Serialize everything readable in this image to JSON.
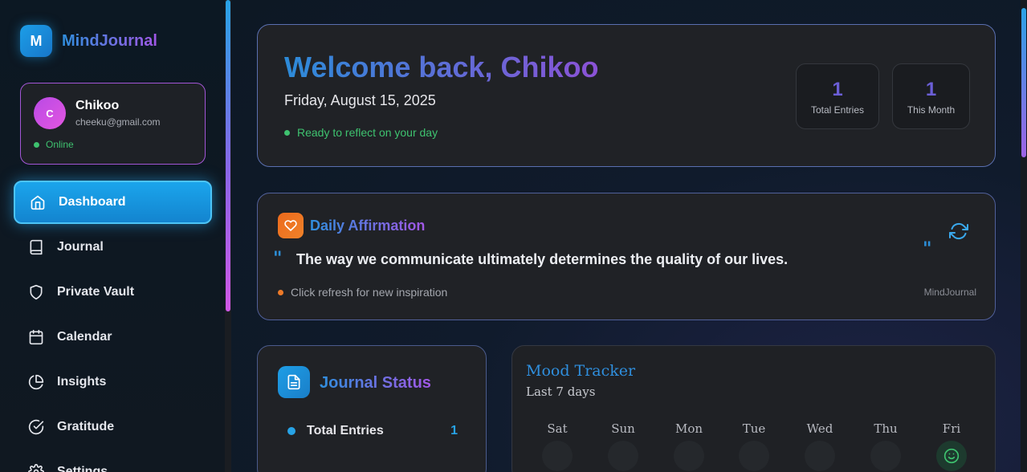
{
  "app": {
    "logo_letter": "M",
    "name": "MindJournal"
  },
  "user": {
    "initial": "C",
    "name": "Chikoo",
    "email": "cheeku@gmail.com",
    "status": "Online"
  },
  "nav": {
    "items": [
      {
        "label": "Dashboard",
        "icon": "home-icon",
        "active": true
      },
      {
        "label": "Journal",
        "icon": "book-icon"
      },
      {
        "label": "Private Vault",
        "icon": "shield-icon"
      },
      {
        "label": "Calendar",
        "icon": "calendar-icon"
      },
      {
        "label": "Insights",
        "icon": "pie-chart-icon"
      },
      {
        "label": "Gratitude",
        "icon": "check-circle-icon"
      },
      {
        "label": "Settings",
        "icon": "gear-icon"
      }
    ]
  },
  "welcome": {
    "title": "Welcome back, Chikoo",
    "date": "Friday, August 15, 2025",
    "status": "Ready to reflect on your day",
    "stats": [
      {
        "value": "1",
        "label": "Total Entries"
      },
      {
        "value": "1",
        "label": "This Month"
      }
    ]
  },
  "affirmation": {
    "title": "Daily Affirmation",
    "icon": "heart-icon",
    "refresh_icon": "refresh-icon",
    "quote_open": "\"",
    "quote_close": "\"",
    "quote": "The way we communicate ultimately determines the quality of our lives.",
    "hint": "Click refresh for new inspiration",
    "brand": "MindJournal"
  },
  "journal_status": {
    "title": "Journal Status",
    "icon": "document-icon",
    "rows": [
      {
        "label": "Total Entries",
        "value": "1"
      }
    ]
  },
  "mood": {
    "title": "Mood Tracker",
    "subtitle": "Last 7 days",
    "days": [
      {
        "label": "Sat",
        "mood": ""
      },
      {
        "label": "Sun",
        "mood": ""
      },
      {
        "label": "Mon",
        "mood": ""
      },
      {
        "label": "Tue",
        "mood": ""
      },
      {
        "label": "Wed",
        "mood": ""
      },
      {
        "label": "Thu",
        "mood": ""
      },
      {
        "label": "Fri",
        "mood": "smile-icon"
      }
    ]
  },
  "colors": {
    "accent": "#1ba5ec",
    "brand_purple": "#8b52d6",
    "success": "#3ec26f",
    "warning": "#ee7a28"
  }
}
